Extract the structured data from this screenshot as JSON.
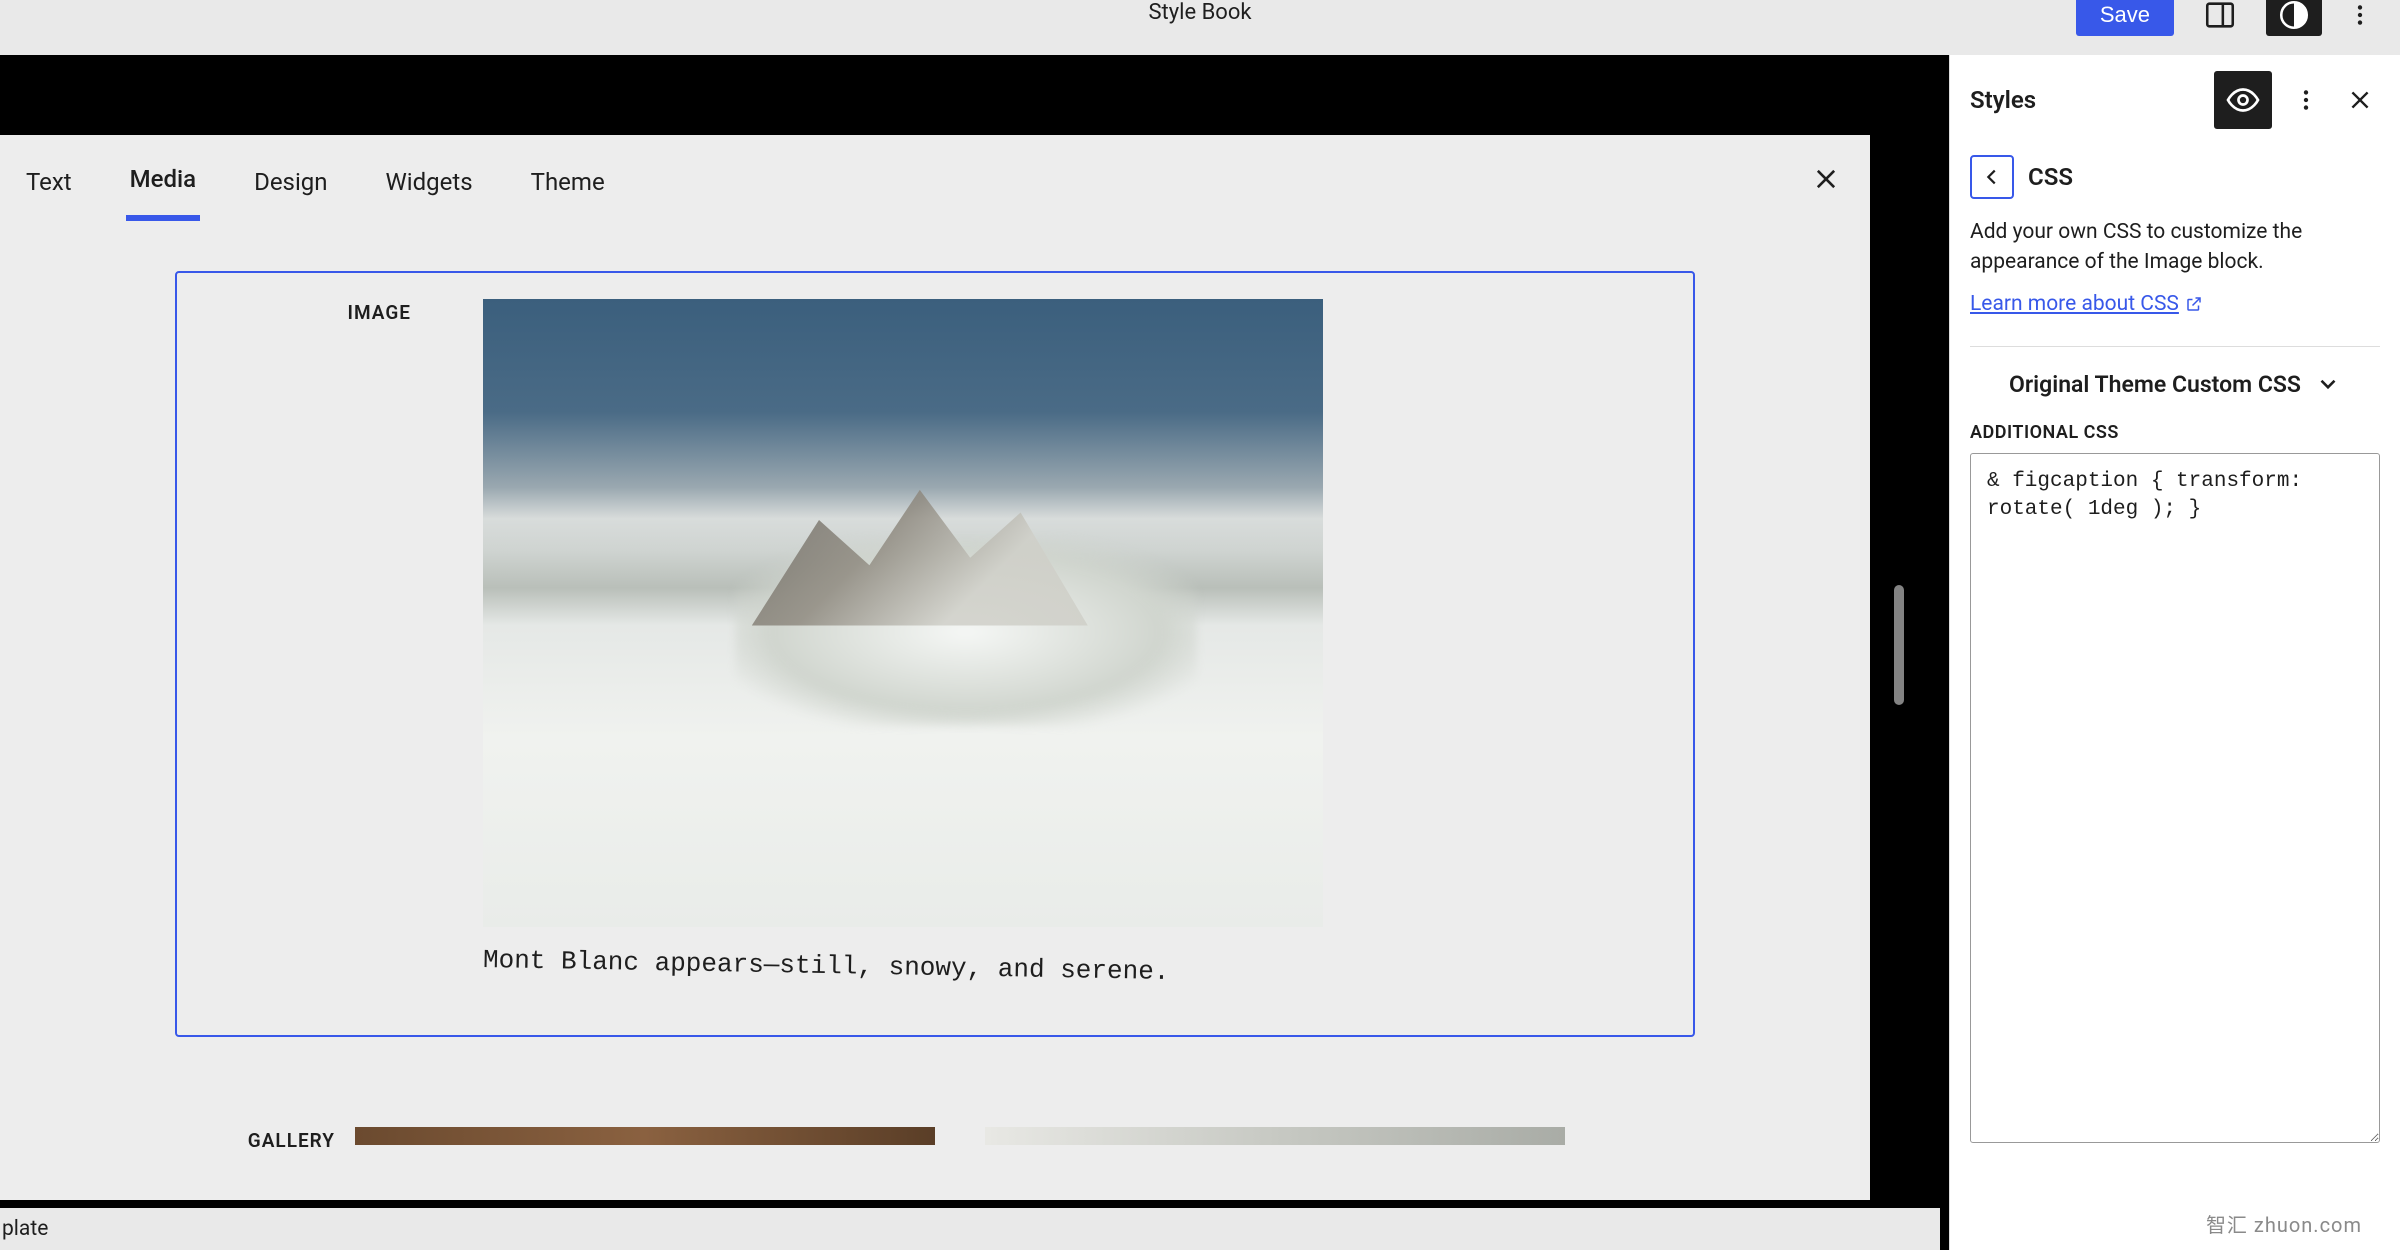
{
  "header": {
    "title": "Style Book",
    "save_label": "Save"
  },
  "tabs": [
    "Text",
    "Media",
    "Design",
    "Widgets",
    "Theme"
  ],
  "active_tab_index": 1,
  "image_block": {
    "label": "Image",
    "caption": "Mont Blanc appears—still, snowy, and serene."
  },
  "gallery_block": {
    "label": "Gallery"
  },
  "sidebar": {
    "title": "Styles",
    "breadcrumb": "CSS",
    "description": "Add your own CSS to customize the appearance of the Image block.",
    "learn_more": "Learn more about CSS",
    "collapsible_label": "Original Theme Custom CSS",
    "field_label": "Additional CSS",
    "css_value": "& figcaption { transform: rotate( 1deg ); }"
  },
  "footer": {
    "breadcrumb_fragment": "plate"
  },
  "watermark": "智汇 zhuon.com"
}
